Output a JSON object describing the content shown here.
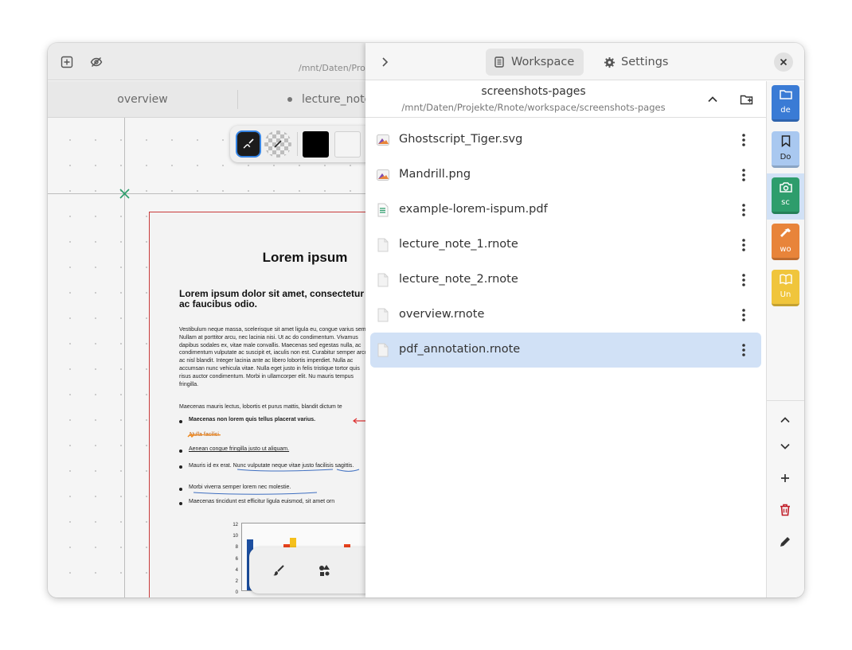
{
  "main": {
    "path_truncated": "/mnt/Daten/Pro",
    "tabs": [
      {
        "label": "overview"
      },
      {
        "label": "lecture_note_"
      }
    ],
    "document": {
      "title": "Lorem ipsum",
      "subtitle": "Lorem ipsum dolor sit amet, consectetur elit. Nunc ac faucibus odio.",
      "body": "Vestibulum neque massa, scelerisque sit amet ligula eu, congue varius sem. Nullam at porttitor arcu, nec lacinia nisi. Ut ac do condimentum. Vivamus dapibus sodales ex, vitae male convallis. Maecenas sed egestas nulla, ac condimentum vulputate ac suscipit et, iaculis non est. Curabitur semper arcu ac nisl blandit. Integer lacinia ante ac libero lobortis imperdiet. Nulla ac accumsan nunc vehicula vitae. Nulla eget justo in felis tristique tortor quis risus auctor condimentum. Morbi in ullamcorper elit. Nu mauris tempus fringilla.",
      "body2": "Maecenas mauris lectus, lobortis et purus mattis, blandit dictum te",
      "list": [
        "Maecenas non lorem quis tellus placerat varius.",
        "Nulla facilisi.",
        "Aenean congue fringilla justo ut aliquam.",
        "Mauris id ex erat. Nunc vulputate neque vitae justo facilisis sagittis.",
        "Morbi viverra semper lorem nec molestie.",
        "Maecenas tincidunt est efficitur ligula euismod, sit amet orn"
      ],
      "chart_ticks": [
        "12",
        "10",
        "8",
        "6",
        "4",
        "2",
        "0"
      ]
    }
  },
  "sidebar": {
    "tabs": {
      "workspace": "Workspace",
      "settings": "Settings"
    },
    "workspace_name": "screenshots-pages",
    "workspace_path": "/mnt/Daten/Projekte/Rnote/workspace/screenshots-pages",
    "files": [
      {
        "name": "Ghostscript_Tiger.svg",
        "icon": "image-icon"
      },
      {
        "name": "Mandrill.png",
        "icon": "image-icon"
      },
      {
        "name": "example-lorem-ispum.pdf",
        "icon": "pdf-icon"
      },
      {
        "name": "lecture_note_1.rnote",
        "icon": "file-icon"
      },
      {
        "name": "lecture_note_2.rnote",
        "icon": "file-icon"
      },
      {
        "name": "overview.rnote",
        "icon": "file-icon"
      },
      {
        "name": "pdf_annotation.rnote",
        "icon": "file-icon",
        "selected": true
      }
    ],
    "workspaces": [
      {
        "label": "de",
        "icon": "folder-icon",
        "color": "#3a7bd5"
      },
      {
        "label": "Do",
        "icon": "bookmark-icon",
        "color": "#a9c8f0"
      },
      {
        "label": "sc",
        "icon": "camera-icon",
        "color": "#2e9d6c"
      },
      {
        "label": "wo",
        "icon": "hammer-icon",
        "color": "#e8843a"
      },
      {
        "label": "Un",
        "icon": "book-icon",
        "color": "#f0c53c"
      }
    ]
  },
  "colors": {
    "accent": "#3584e4",
    "selected_row": "#d1e1f6",
    "delete": "#c01c28"
  }
}
